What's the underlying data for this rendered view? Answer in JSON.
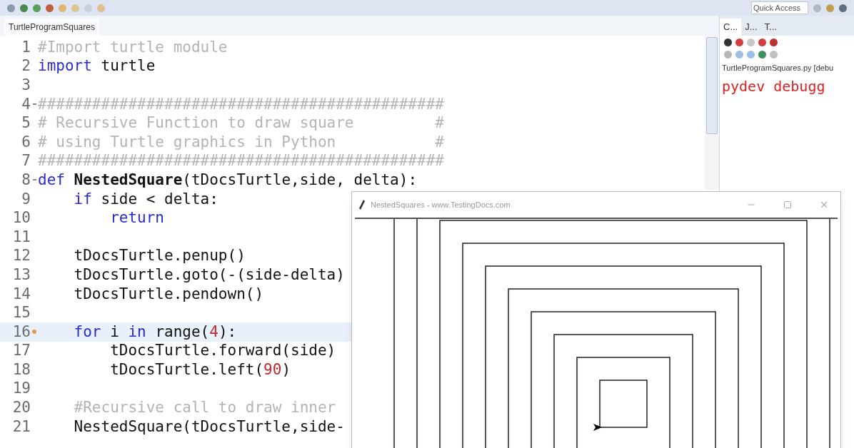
{
  "toolbar": {
    "quick_access": {
      "placeholder": "Quick Access"
    }
  },
  "editor": {
    "tab": {
      "label": "TurtleProgramSquares",
      "selected": true
    },
    "lines": [
      {
        "number": "1",
        "foldable": false,
        "breakpoint": false,
        "current": false,
        "tokens": [
          {
            "kind": "comment",
            "text": "#Import turtle module"
          }
        ]
      },
      {
        "number": "2",
        "foldable": false,
        "breakpoint": false,
        "current": false,
        "tokens": [
          {
            "kind": "kw",
            "text": "import"
          },
          {
            "kind": "plain",
            "text": " turtle"
          }
        ]
      },
      {
        "number": "3",
        "foldable": false,
        "breakpoint": false,
        "current": false
      },
      {
        "number": "4",
        "foldable": true,
        "breakpoint": false,
        "current": false,
        "tokens": [
          {
            "kind": "comment",
            "text": "#############################################"
          }
        ]
      },
      {
        "number": "5",
        "foldable": false,
        "breakpoint": false,
        "current": false,
        "tokens": [
          {
            "kind": "comment",
            "text": "# Recursive Function to draw square         #"
          }
        ]
      },
      {
        "number": "6",
        "foldable": false,
        "breakpoint": false,
        "current": false,
        "tokens": [
          {
            "kind": "comment",
            "text": "# using Turtle graphics in Python           #"
          }
        ]
      },
      {
        "number": "7",
        "foldable": false,
        "breakpoint": false,
        "current": false,
        "tokens": [
          {
            "kind": "comment",
            "text": "#############################################"
          }
        ]
      },
      {
        "number": "8",
        "foldable": true,
        "breakpoint": false,
        "current": false,
        "tokens": [
          {
            "kind": "kw",
            "text": "def"
          },
          {
            "kind": "fn",
            "text": " NestedSquare"
          },
          {
            "kind": "plain",
            "text": "(tDocsTurtle,side, delta):"
          }
        ]
      },
      {
        "number": "9",
        "foldable": false,
        "breakpoint": false,
        "current": false,
        "tokens": [
          {
            "kind": "kw",
            "text": "    if"
          },
          {
            "kind": "plain",
            "text": " side < delta:"
          }
        ]
      },
      {
        "number": "10",
        "foldable": false,
        "breakpoint": false,
        "current": false,
        "tokens": [
          {
            "kind": "kw",
            "text": "        return"
          }
        ]
      },
      {
        "number": "11",
        "foldable": false,
        "breakpoint": false,
        "current": false
      },
      {
        "number": "12",
        "foldable": false,
        "breakpoint": false,
        "current": false,
        "tokens": [
          {
            "kind": "plain",
            "text": "    tDocsTurtle.penup()"
          }
        ]
      },
      {
        "number": "13",
        "foldable": false,
        "breakpoint": false,
        "current": false,
        "tokens": [
          {
            "kind": "plain",
            "text": "    tDocsTurtle.goto(-(side-delta)"
          }
        ]
      },
      {
        "number": "14",
        "foldable": false,
        "breakpoint": false,
        "current": false,
        "tokens": [
          {
            "kind": "plain",
            "text": "    tDocsTurtle.pendown()"
          }
        ]
      },
      {
        "number": "15",
        "foldable": false,
        "breakpoint": false,
        "current": false
      },
      {
        "number": "16",
        "foldable": false,
        "breakpoint": true,
        "current": true,
        "tokens": [
          {
            "kind": "kw",
            "text": "    for"
          },
          {
            "kind": "plain",
            "text": " i "
          },
          {
            "kind": "kw",
            "text": "in"
          },
          {
            "kind": "plain",
            "text": " range("
          },
          {
            "kind": "num",
            "text": "4"
          },
          {
            "kind": "plain",
            "text": "):"
          }
        ]
      },
      {
        "number": "17",
        "foldable": false,
        "breakpoint": false,
        "current": false,
        "tokens": [
          {
            "kind": "plain",
            "text": "        tDocsTurtle.forward(side)"
          }
        ]
      },
      {
        "number": "18",
        "foldable": false,
        "breakpoint": false,
        "current": false,
        "tokens": [
          {
            "kind": "plain",
            "text": "        tDocsTurtle.left("
          },
          {
            "kind": "num",
            "text": "90"
          },
          {
            "kind": "plain",
            "text": ")"
          }
        ]
      },
      {
        "number": "19",
        "foldable": false,
        "breakpoint": false,
        "current": false
      },
      {
        "number": "20",
        "foldable": false,
        "breakpoint": false,
        "current": false,
        "tokens": [
          {
            "kind": "comment",
            "text": "    #Recursive call to draw inner"
          }
        ]
      },
      {
        "number": "21",
        "foldable": false,
        "breakpoint": false,
        "current": false,
        "tokens": [
          {
            "kind": "plain",
            "text": "    NestedSquare(tDocsTurtle,side-"
          }
        ]
      }
    ]
  },
  "side_panel": {
    "tabs": [
      {
        "label": "C...",
        "selected": true
      },
      {
        "label": "J...",
        "selected": false
      },
      {
        "label": "T...",
        "selected": false
      }
    ],
    "console_title": "TurtleProgramSquares.py [debu",
    "output": "pydev debugg"
  },
  "turtle_window": {
    "title": "NestedSquares - www.TestingDocs.com"
  }
}
